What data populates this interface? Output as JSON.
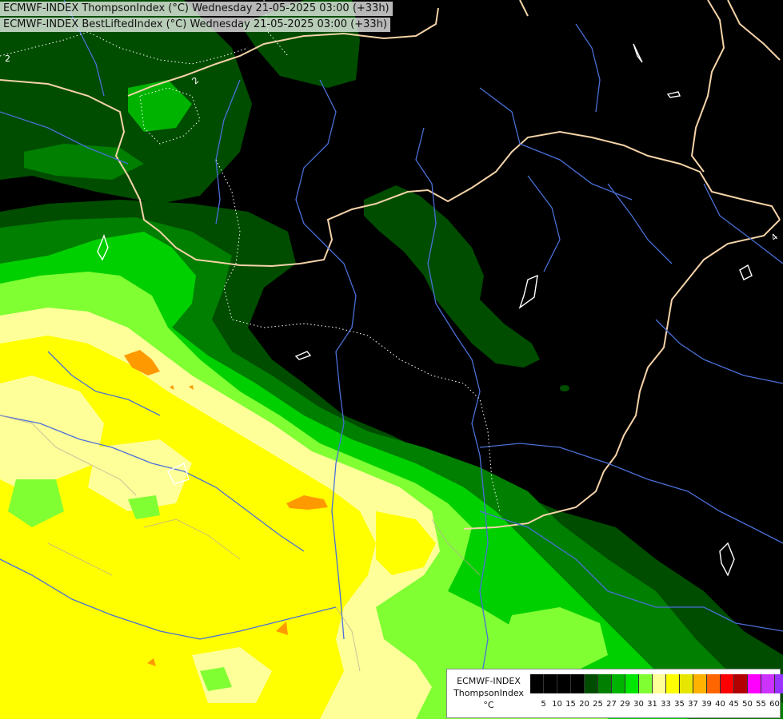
{
  "header": {
    "line1": "ECMWF-INDEX ThompsonIndex (°C) Wednesday 21-05-2025 03:00 (+33h)",
    "line2": "ECMWF-INDEX BestLiftedIndex (°C) Wednesday 21-05-2025 03:00 (+33h)"
  },
  "legend": {
    "title_line1": "ECMWF-INDEX",
    "title_line2": "ThompsonIndex",
    "unit": "°C",
    "colors": [
      "#000000",
      "#000000",
      "#000000",
      "#000000",
      "#004d00",
      "#007f00",
      "#00b300",
      "#00e600",
      "#80ff33",
      "#ffff99",
      "#ffff00",
      "#e6e600",
      "#ffb300",
      "#ff6600",
      "#ff0000",
      "#b30000",
      "#ff00ff",
      "#cc33ff",
      "#9933ff",
      "#6600ff",
      "#0000ff"
    ],
    "ticks": [
      "5",
      "10",
      "15",
      "20",
      "25",
      "27",
      "29",
      "30",
      "31",
      "33",
      "35",
      "37",
      "39",
      "40",
      "45",
      "50",
      "55",
      "60"
    ]
  },
  "contour_labels": [
    "2",
    "2",
    "4"
  ],
  "palette": {
    "background": "#000000",
    "dark_green": "#005000",
    "mid_green": "#007f00",
    "green": "#00b300",
    "bright_green": "#00e600",
    "lime": "#80ff33",
    "pale_yellow": "#ffff99",
    "yellow": "#ffff00",
    "orange": "#ffb300",
    "dark_orange": "#ff8000",
    "border_color": "#f5d3a8",
    "river_color": "#4a6fd8",
    "contour_color": "#ffffff"
  }
}
